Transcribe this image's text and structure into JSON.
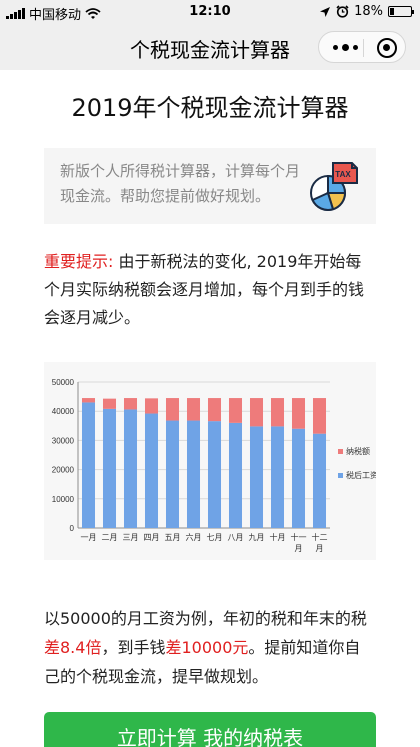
{
  "status_bar": {
    "carrier": "中国移动",
    "time": "12:10",
    "battery_text": "18%",
    "battery_level": 0.18
  },
  "nav": {
    "title": "个税现金流计算器"
  },
  "page": {
    "title": "2019年个税现金流计算器"
  },
  "intro": {
    "text": "新版个人所得税计算器，计算每个月现金流。帮助您提前做好规划。",
    "icon_label": "TAX"
  },
  "notice": {
    "label": "重要提示:",
    "text": " 由于新税法的变化, 2019年开始每个月实际纳税额会逐月增加，每个月到手的钱会逐月减少。"
  },
  "chart_data": {
    "type": "bar",
    "stacked": true,
    "categories": [
      "一月",
      "二月",
      "三月",
      "四月",
      "五月",
      "六月",
      "七月",
      "八月",
      "九月",
      "十月",
      "十一月",
      "十二月"
    ],
    "series": [
      {
        "name": "税后工资",
        "color": "#6fa3e6",
        "values": [
          43000,
          40800,
          40600,
          39200,
          36800,
          36800,
          36600,
          36000,
          34800,
          34800,
          34000,
          32300
        ]
      },
      {
        "name": "纳税额",
        "color": "#ee7b7b",
        "values": [
          1500,
          3500,
          3900,
          5200,
          7700,
          7700,
          7900,
          8500,
          9700,
          9700,
          10500,
          12200
        ]
      }
    ],
    "ylim": [
      0,
      50000
    ],
    "yticks": [
      0,
      10000,
      20000,
      30000,
      40000,
      50000
    ],
    "grid": true,
    "legend": "right"
  },
  "summary": {
    "part1": "以50000的月工资为例，年初的税和年末的税",
    "highlight1": "差8.4倍",
    "part2": "，到手钱",
    "highlight2": "差10000元",
    "part3": "。提前知道你自己的个税现金流，提早做规划。"
  },
  "cta": {
    "label": "立即计算 我的纳税表"
  },
  "colors": {
    "accent_green": "#2fb74a",
    "highlight_red": "#e02020"
  }
}
